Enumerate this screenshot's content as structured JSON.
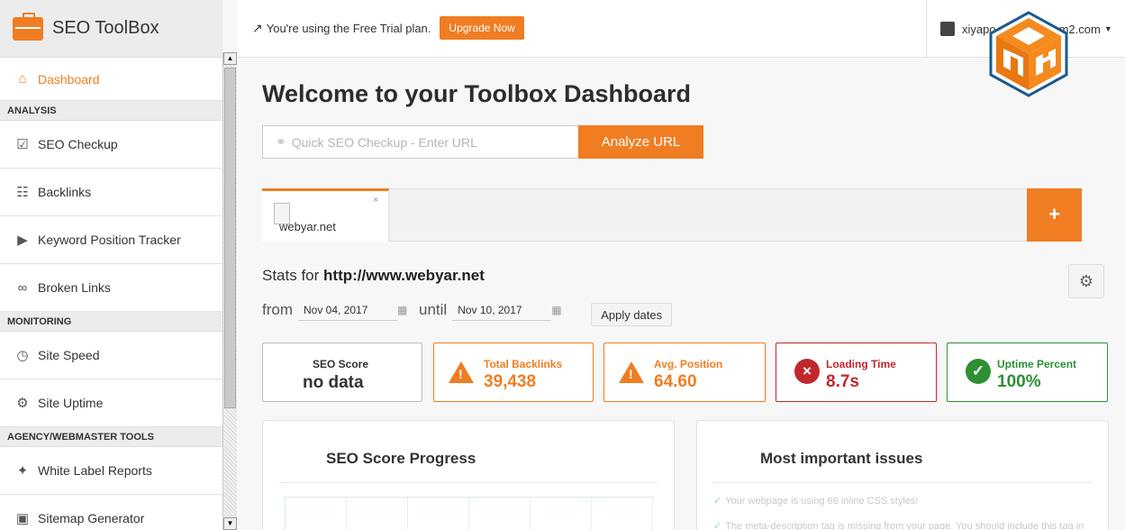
{
  "brand": {
    "name": "SEO ToolBox"
  },
  "topbar": {
    "trial_text": "You're using the Free Trial plan.",
    "upgrade_label": "Upgrade Now",
    "account_text": "xiyapo",
    "account_text_tail": "m2.com"
  },
  "sidebar": {
    "items": [
      {
        "label": "Dashboard",
        "icon": "home-icon"
      },
      {
        "section": "ANALYSIS"
      },
      {
        "label": "SEO Checkup",
        "icon": "clipboard-check-icon"
      },
      {
        "label": "Backlinks",
        "icon": "globe-icon"
      },
      {
        "label": "Keyword Position Tracker",
        "icon": "tag-icon"
      },
      {
        "label": "Broken Links",
        "icon": "broken-link-icon"
      },
      {
        "section": "MONITORING"
      },
      {
        "label": "Site Speed",
        "icon": "stopwatch-icon"
      },
      {
        "label": "Site Uptime",
        "icon": "uptime-icon"
      },
      {
        "section": "AGENCY/WEBMASTER TOOLS"
      },
      {
        "label": "White Label Reports",
        "icon": "magic-wand-icon"
      },
      {
        "label": "Sitemap Generator",
        "icon": "sitemap-icon"
      }
    ]
  },
  "main": {
    "title": "Welcome to your Toolbox Dashboard",
    "quick_placeholder": "Quick SEO Checkup - Enter URL",
    "analyze_label": "Analyze URL",
    "tab_label": "webyar.net",
    "stats_prefix": "Stats for",
    "stats_url": "http://www.webyar.net",
    "from_label": "from",
    "from_date": "Nov 04, 2017",
    "until_label": "until",
    "until_date": "Nov 10, 2017",
    "apply_label": "Apply dates"
  },
  "cards": [
    {
      "label": "SEO Score",
      "value": "no data",
      "status": "none",
      "color": "#333333"
    },
    {
      "label": "Total Backlinks",
      "value": "39,438",
      "status": "warning",
      "color": "#f07d22"
    },
    {
      "label": "Avg. Position",
      "value": "64.60",
      "status": "warning",
      "color": "#f07d22"
    },
    {
      "label": "Loading Time",
      "value": "8.7s",
      "status": "error",
      "color": "#c0282e"
    },
    {
      "label": "Uptime Percent",
      "value": "100%",
      "status": "ok",
      "color": "#2e8f35"
    }
  ],
  "panels": {
    "progress_title": "SEO Score Progress",
    "issues_title": "Most important issues",
    "issues": [
      "Your webpage is using 66 inline CSS styles!",
      "The meta-description tag is missing from your page. You should include this tag in"
    ]
  },
  "colors": {
    "accent": "#f07d22",
    "danger": "#c0282e",
    "success": "#2e8f35"
  }
}
